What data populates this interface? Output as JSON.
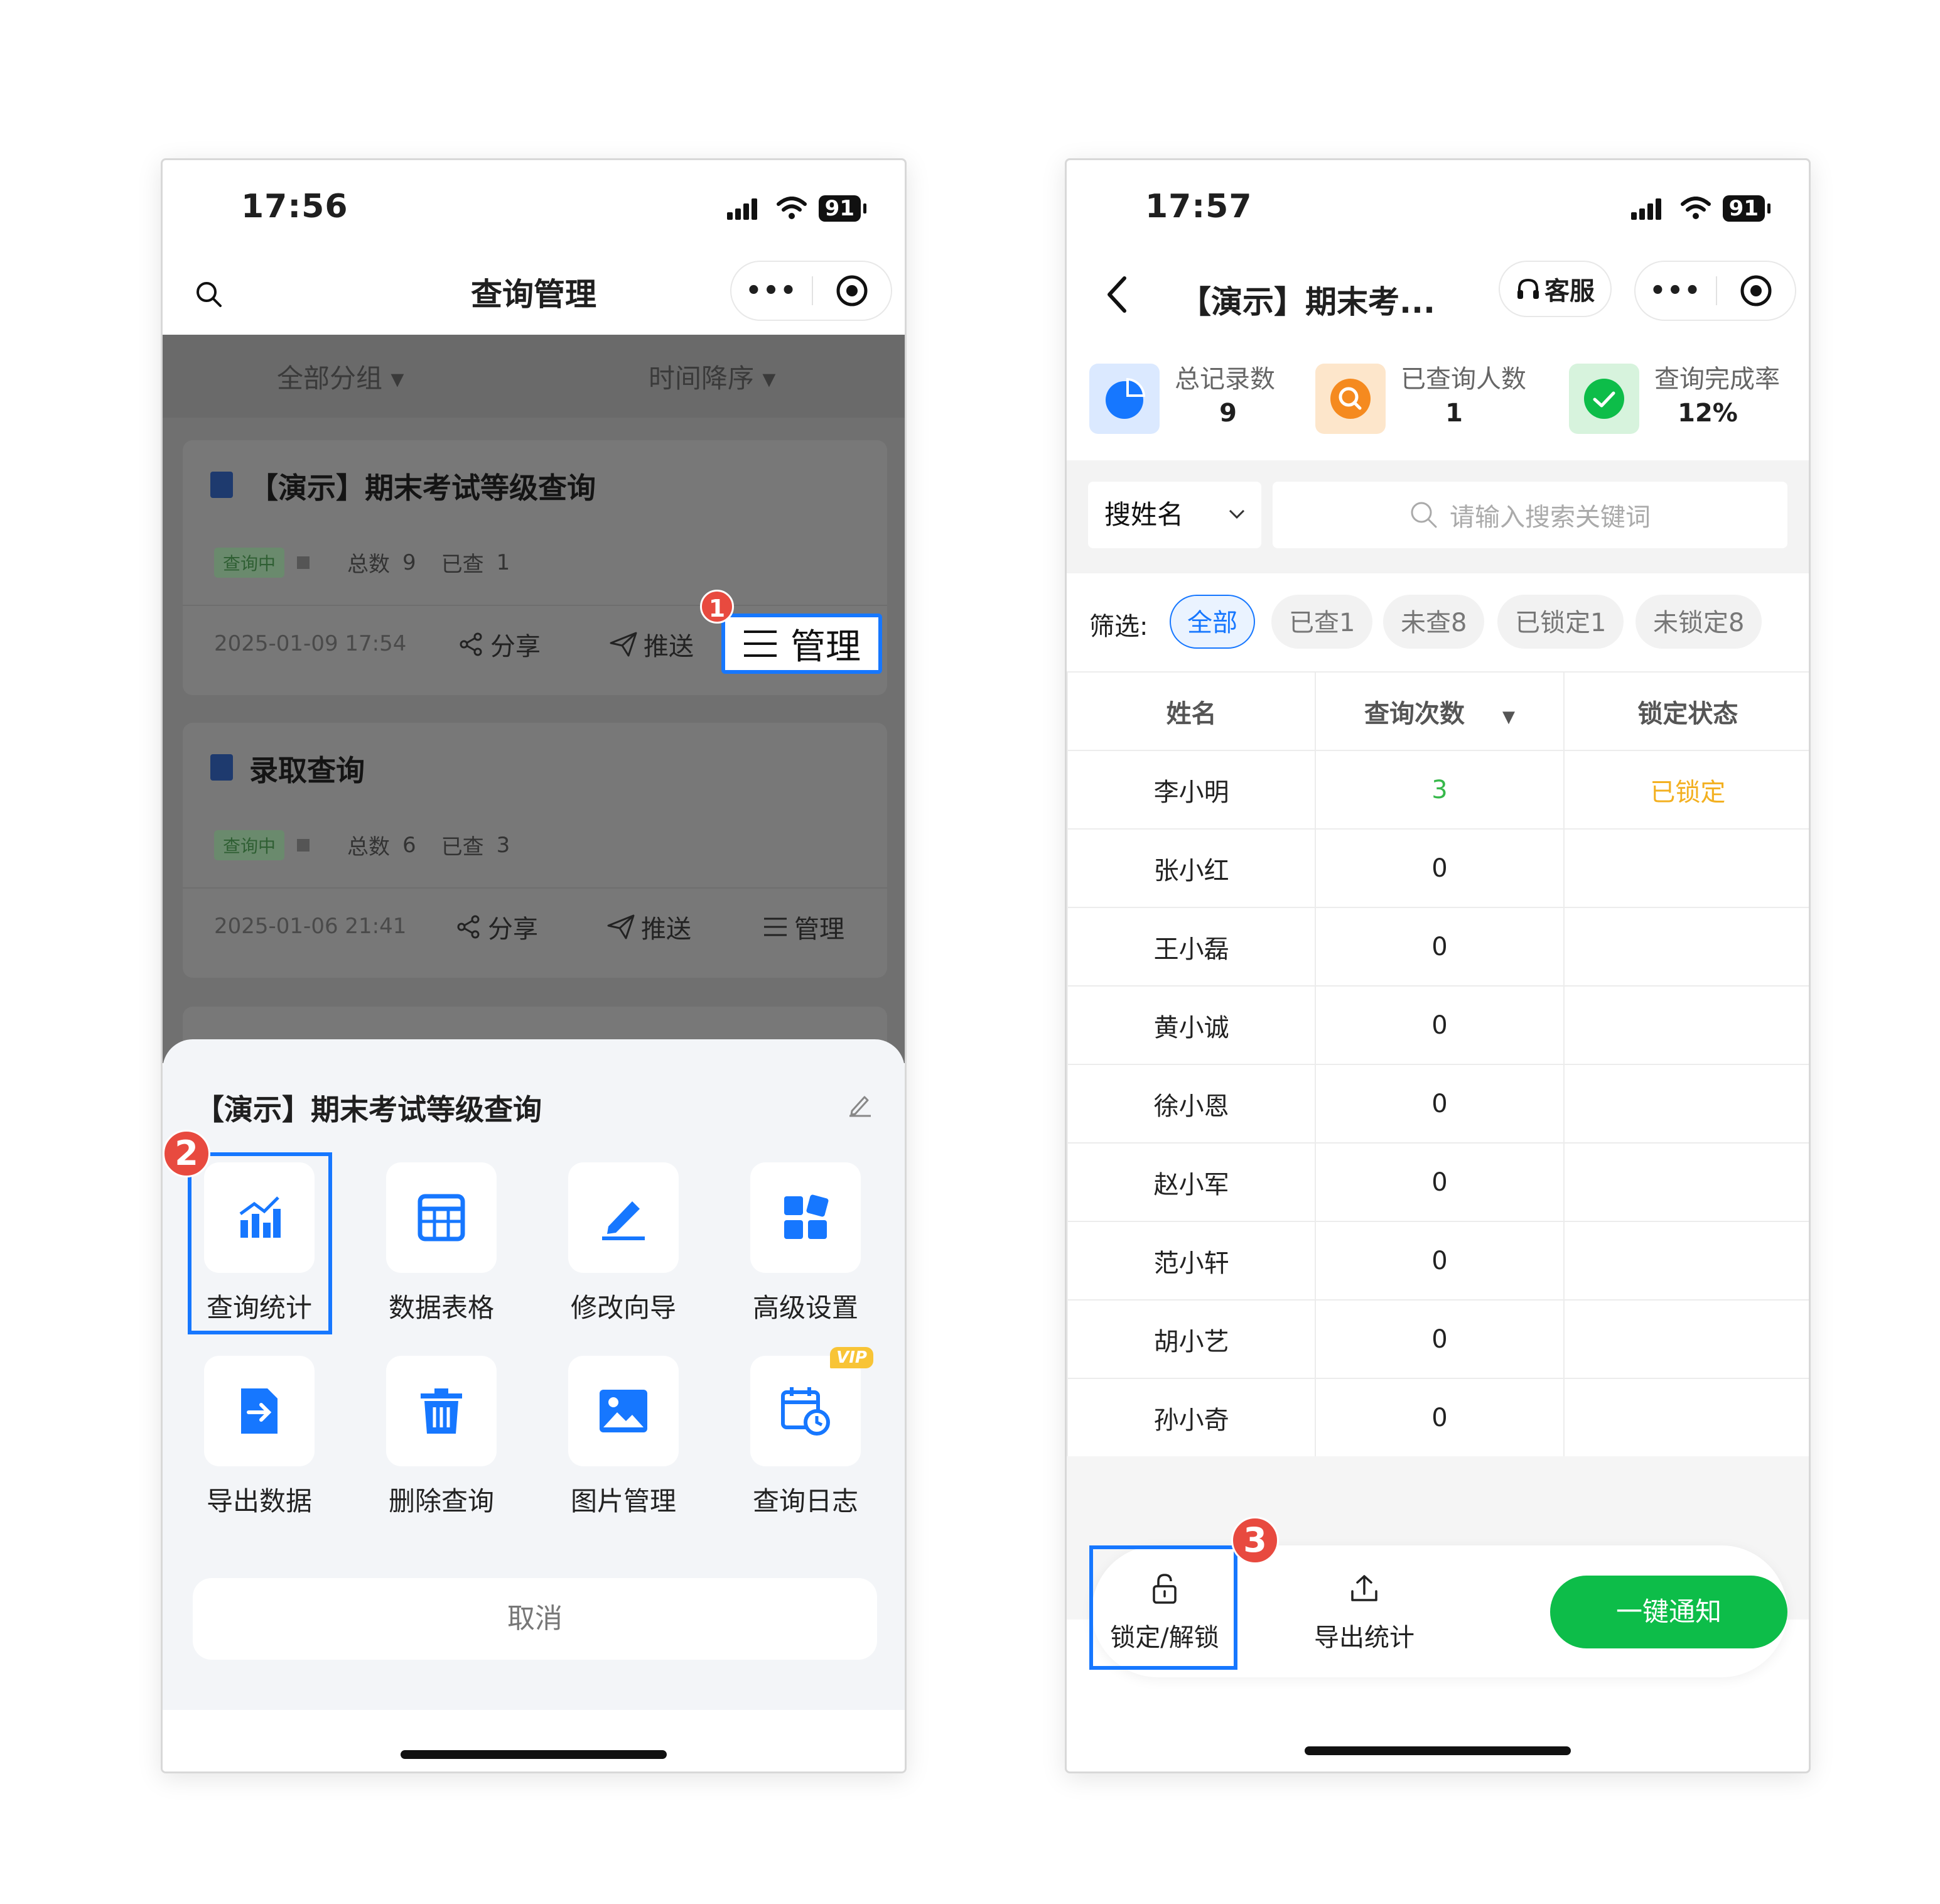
{
  "left": {
    "status": {
      "time": "17:56",
      "battery": "91"
    },
    "nav": {
      "title": "查询管理"
    },
    "filters": {
      "group": "全部分组",
      "sort": "时间降序"
    },
    "cards": [
      {
        "title": "【演示】期末考试等级查询",
        "tag": "查询中",
        "total_label": "总数",
        "total": "9",
        "checked_label": "已查",
        "checked": "1",
        "date": "2025-01-09 17:54",
        "share": "分享",
        "push": "推送",
        "manage": "管理"
      },
      {
        "title": "录取查询",
        "tag": "查询中",
        "total_label": "总数",
        "total": "6",
        "checked_label": "已查",
        "checked": "3",
        "date": "2025-01-06 21:41",
        "share": "分享",
        "push": "推送",
        "manage": "管理"
      }
    ],
    "sheet": {
      "title": "【演示】期末考试等级查询",
      "items": [
        "查询统计",
        "数据表格",
        "修改向导",
        "高级设置",
        "导出数据",
        "删除查询",
        "图片管理",
        "查询日志"
      ],
      "vip": "VIP",
      "cancel": "取消"
    },
    "badges": [
      "1",
      "2"
    ]
  },
  "right": {
    "status": {
      "time": "17:57",
      "battery": "91"
    },
    "nav": {
      "title": "【演示】期末考...",
      "kefu": "客服"
    },
    "metrics": [
      {
        "label": "总记录数",
        "value": "9"
      },
      {
        "label": "已查询人数",
        "value": "1"
      },
      {
        "label": "查询完成率",
        "value": "12%"
      }
    ],
    "search": {
      "field": "搜姓名",
      "placeholder": "请输入搜索关键词"
    },
    "filter": {
      "label": "筛选:",
      "chips": [
        "全部",
        "已查1",
        "未查8",
        "已锁定1",
        "未锁定8"
      ]
    },
    "table": {
      "headers": [
        "姓名",
        "查询次数",
        "锁定状态"
      ],
      "rows": [
        [
          "李小明",
          "3",
          "已锁定"
        ],
        [
          "张小红",
          "0",
          ""
        ],
        [
          "王小磊",
          "0",
          ""
        ],
        [
          "黄小诚",
          "0",
          ""
        ],
        [
          "徐小恩",
          "0",
          ""
        ],
        [
          "赵小军",
          "0",
          ""
        ],
        [
          "范小轩",
          "0",
          ""
        ],
        [
          "胡小艺",
          "0",
          ""
        ],
        [
          "孙小奇",
          "0",
          ""
        ]
      ]
    },
    "toolbar": {
      "lock": "锁定/解锁",
      "export": "导出统计",
      "notify": "一键通知"
    },
    "badge": "3"
  },
  "colors": {
    "accent": "#1677ff",
    "green": "#0dbd49",
    "badge": "#e84a3f",
    "locked": "#f3b020"
  }
}
